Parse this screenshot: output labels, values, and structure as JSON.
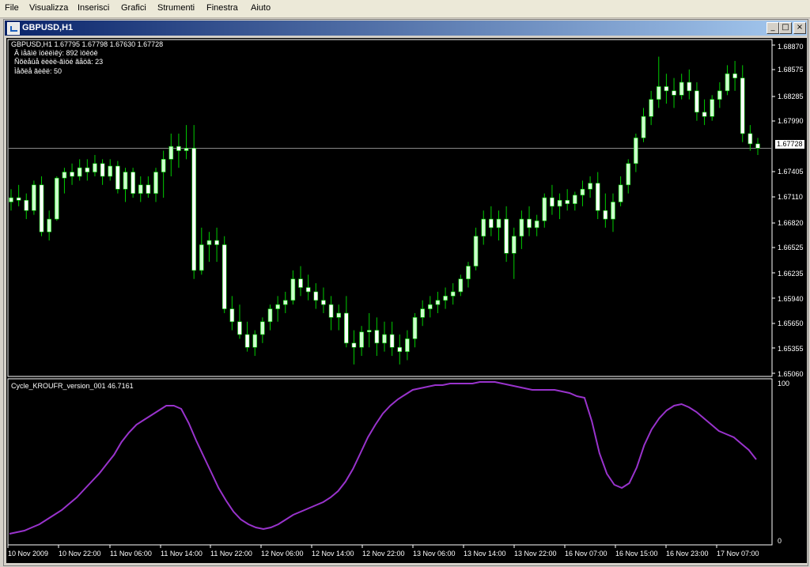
{
  "menu": [
    "File",
    "Visualizza",
    "Inserisci",
    "Grafici",
    "Strumenti",
    "Finestra",
    "Aiuto"
  ],
  "window": {
    "title": "GBPUSD,H1",
    "minimize": "_",
    "restore": "□",
    "close": "×"
  },
  "chart": {
    "header": "GBPUSD,H1  1.67795 1.67798 1.67630 1.67728",
    "info_lines": [
      "Ä ìåâìë ïóëëìêý: 892 ìöëóë",
      "Ñõèåüå ëèèë-ãìöé ãåöâ: 23",
      "Ìåðëå ãèêë: 50"
    ],
    "price_labels": [
      "1.68870",
      "1.68575",
      "1.68285",
      "1.67990",
      "1.67405",
      "1.67110",
      "1.66820",
      "1.66525",
      "1.66235",
      "1.65940",
      "1.65650",
      "1.65355",
      "1.65060"
    ],
    "current_price": "1.67728",
    "indicator_label": "Cycle_KROUFR_version_001 46.7161",
    "indicator_scale": [
      "100",
      "0"
    ],
    "time_labels": [
      "10 Nov 2009",
      "10 Nov 22:00",
      "11 Nov 06:00",
      "11 Nov 14:00",
      "11 Nov 22:00",
      "12 Nov 06:00",
      "12 Nov 14:00",
      "12 Nov 22:00",
      "13 Nov 06:00",
      "13 Nov 14:00",
      "13 Nov 22:00",
      "16 Nov 07:00",
      "16 Nov 15:00",
      "16 Nov 23:00",
      "17 Nov 07:00"
    ],
    "colors": {
      "bull": "#ccffcc",
      "bear": "#ffffff",
      "wick": "#00cc00",
      "indicator": "#9933cc",
      "grid": "#ffffff",
      "bg": "#000000"
    }
  },
  "chart_data": {
    "type": "candlestick",
    "ylim": [
      1.6506,
      1.69
    ],
    "candles": [
      [
        1.671,
        1.6725,
        1.67,
        1.6715
      ],
      [
        1.6715,
        1.673,
        1.6705,
        1.6712
      ],
      [
        1.6712,
        1.672,
        1.669,
        1.67
      ],
      [
        1.67,
        1.6735,
        1.6695,
        1.673
      ],
      [
        1.673,
        1.674,
        1.667,
        1.6675
      ],
      [
        1.6675,
        1.67,
        1.6665,
        1.669
      ],
      [
        1.669,
        1.674,
        1.6688,
        1.6738
      ],
      [
        1.6738,
        1.675,
        1.672,
        1.6745
      ],
      [
        1.6745,
        1.6755,
        1.673,
        1.674
      ],
      [
        1.674,
        1.676,
        1.6735,
        1.675
      ],
      [
        1.675,
        1.676,
        1.6735,
        1.6745
      ],
      [
        1.6745,
        1.6765,
        1.674,
        1.6755
      ],
      [
        1.6755,
        1.676,
        1.673,
        1.674
      ],
      [
        1.674,
        1.676,
        1.6735,
        1.6752
      ],
      [
        1.6752,
        1.6758,
        1.672,
        1.6725
      ],
      [
        1.6725,
        1.675,
        1.671,
        1.6745
      ],
      [
        1.6745,
        1.675,
        1.6715,
        1.672
      ],
      [
        1.672,
        1.674,
        1.671,
        1.673
      ],
      [
        1.673,
        1.674,
        1.6715,
        1.672
      ],
      [
        1.672,
        1.675,
        1.671,
        1.6745
      ],
      [
        1.6745,
        1.677,
        1.6715,
        1.676
      ],
      [
        1.676,
        1.679,
        1.674,
        1.6775
      ],
      [
        1.6775,
        1.679,
        1.675,
        1.677
      ],
      [
        1.677,
        1.68,
        1.676,
        1.6773
      ],
      [
        1.6773,
        1.68,
        1.662,
        1.663
      ],
      [
        1.663,
        1.668,
        1.6625,
        1.666
      ],
      [
        1.666,
        1.6675,
        1.664,
        1.6665
      ],
      [
        1.6665,
        1.668,
        1.664,
        1.666
      ],
      [
        1.666,
        1.667,
        1.658,
        1.6585
      ],
      [
        1.6585,
        1.66,
        1.656,
        1.657
      ],
      [
        1.657,
        1.659,
        1.655,
        1.6555
      ],
      [
        1.6555,
        1.657,
        1.6535,
        1.654
      ],
      [
        1.654,
        1.656,
        1.653,
        1.6555
      ],
      [
        1.6555,
        1.6575,
        1.6545,
        1.657
      ],
      [
        1.657,
        1.659,
        1.656,
        1.6585
      ],
      [
        1.6585,
        1.66,
        1.657,
        1.659
      ],
      [
        1.659,
        1.6605,
        1.658,
        1.6595
      ],
      [
        1.6595,
        1.663,
        1.659,
        1.662
      ],
      [
        1.662,
        1.6635,
        1.66,
        1.661
      ],
      [
        1.661,
        1.6625,
        1.6595,
        1.6605
      ],
      [
        1.6605,
        1.6615,
        1.6585,
        1.6595
      ],
      [
        1.6595,
        1.661,
        1.658,
        1.659
      ],
      [
        1.659,
        1.66,
        1.656,
        1.6575
      ],
      [
        1.6575,
        1.659,
        1.656,
        1.658
      ],
      [
        1.658,
        1.66,
        1.654,
        1.6545
      ],
      [
        1.6545,
        1.656,
        1.652,
        1.654
      ],
      [
        1.654,
        1.6565,
        1.653,
        1.6558
      ],
      [
        1.6558,
        1.658,
        1.654,
        1.656
      ],
      [
        1.656,
        1.6575,
        1.653,
        1.6545
      ],
      [
        1.6545,
        1.657,
        1.6535,
        1.6555
      ],
      [
        1.6555,
        1.657,
        1.653,
        1.654
      ],
      [
        1.654,
        1.6555,
        1.652,
        1.6535
      ],
      [
        1.6535,
        1.656,
        1.6525,
        1.655
      ],
      [
        1.655,
        1.658,
        1.654,
        1.6575
      ],
      [
        1.6575,
        1.6595,
        1.6565,
        1.6585
      ],
      [
        1.6585,
        1.66,
        1.6575,
        1.659
      ],
      [
        1.659,
        1.6605,
        1.658,
        1.6595
      ],
      [
        1.6595,
        1.661,
        1.6585,
        1.66
      ],
      [
        1.66,
        1.6615,
        1.659,
        1.6605
      ],
      [
        1.6605,
        1.6625,
        1.66,
        1.662
      ],
      [
        1.662,
        1.664,
        1.661,
        1.6635
      ],
      [
        1.6635,
        1.668,
        1.663,
        1.667
      ],
      [
        1.667,
        1.67,
        1.666,
        1.669
      ],
      [
        1.669,
        1.6705,
        1.667,
        1.668
      ],
      [
        1.668,
        1.67,
        1.6665,
        1.669
      ],
      [
        1.669,
        1.6705,
        1.664,
        1.665
      ],
      [
        1.665,
        1.668,
        1.662,
        1.667
      ],
      [
        1.667,
        1.67,
        1.6655,
        1.669
      ],
      [
        1.669,
        1.6705,
        1.667,
        1.668
      ],
      [
        1.668,
        1.6695,
        1.667,
        1.6688
      ],
      [
        1.6688,
        1.672,
        1.668,
        1.6715
      ],
      [
        1.6715,
        1.673,
        1.6695,
        1.6705
      ],
      [
        1.6705,
        1.672,
        1.669,
        1.6712
      ],
      [
        1.6712,
        1.6725,
        1.67,
        1.6708
      ],
      [
        1.6708,
        1.6722,
        1.67,
        1.6718
      ],
      [
        1.6718,
        1.6735,
        1.6705,
        1.6725
      ],
      [
        1.6725,
        1.674,
        1.6715,
        1.6732
      ],
      [
        1.6732,
        1.6745,
        1.669,
        1.67
      ],
      [
        1.67,
        1.672,
        1.668,
        1.669
      ],
      [
        1.669,
        1.672,
        1.6675,
        1.671
      ],
      [
        1.671,
        1.674,
        1.6705,
        1.673
      ],
      [
        1.673,
        1.676,
        1.672,
        1.6755
      ],
      [
        1.6755,
        1.679,
        1.6745,
        1.6785
      ],
      [
        1.6785,
        1.682,
        1.678,
        1.681
      ],
      [
        1.681,
        1.684,
        1.68,
        1.683
      ],
      [
        1.683,
        1.688,
        1.682,
        1.6845
      ],
      [
        1.6845,
        1.686,
        1.6825,
        1.684
      ],
      [
        1.684,
        1.6855,
        1.682,
        1.6835
      ],
      [
        1.6835,
        1.686,
        1.683,
        1.685
      ],
      [
        1.685,
        1.6865,
        1.683,
        1.684
      ],
      [
        1.684,
        1.685,
        1.6805,
        1.6815
      ],
      [
        1.6815,
        1.683,
        1.68,
        1.681
      ],
      [
        1.681,
        1.6835,
        1.6805,
        1.683
      ],
      [
        1.683,
        1.685,
        1.682,
        1.684
      ],
      [
        1.684,
        1.687,
        1.6835,
        1.686
      ],
      [
        1.686,
        1.6875,
        1.684,
        1.6855
      ],
      [
        1.6855,
        1.687,
        1.678,
        1.679
      ],
      [
        1.679,
        1.68,
        1.677,
        1.6778
      ],
      [
        1.6778,
        1.6785,
        1.6765,
        1.6773
      ]
    ],
    "indicator": {
      "name": "Cycle_KROUFR_version_001",
      "ylim": [
        0,
        100
      ],
      "values": [
        5,
        6,
        7,
        9,
        11,
        14,
        17,
        20,
        24,
        28,
        33,
        38,
        43,
        49,
        55,
        63,
        69,
        74,
        77,
        80,
        83,
        86,
        86,
        84,
        75,
        64,
        54,
        44,
        34,
        26,
        19,
        14,
        11,
        9,
        8,
        9,
        11,
        14,
        17,
        19,
        21,
        23,
        25,
        28,
        32,
        38,
        46,
        56,
        66,
        74,
        81,
        86,
        90,
        93,
        96,
        97,
        98,
        99,
        99,
        100,
        100,
        100,
        100,
        101,
        101,
        101,
        100,
        99,
        98,
        97,
        96,
        96,
        96,
        96,
        95,
        94,
        92,
        91,
        76,
        56,
        43,
        36,
        34,
        37,
        47,
        61,
        71,
        78,
        83,
        86,
        87,
        85,
        82,
        78,
        74,
        70,
        68,
        66,
        62,
        58,
        52
      ]
    }
  }
}
